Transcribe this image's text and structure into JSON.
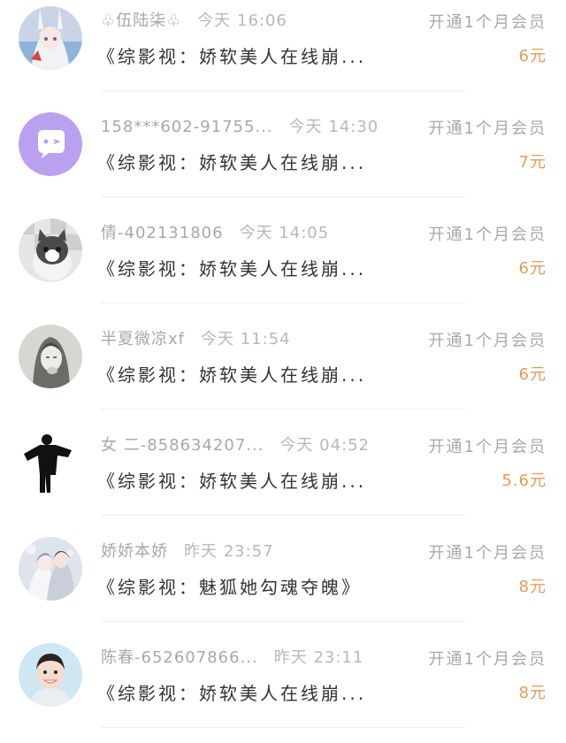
{
  "colors": {
    "secondary_text": "#a8a8a8",
    "primary_text": "#333333",
    "amount": "#e39c55",
    "divider": "#eeeeee"
  },
  "rows": [
    {
      "name": "♧伍陆柒♧",
      "time": "今天 16:06",
      "title": "《综影视：娇软美人在线崩...",
      "action": "开通1个月会员",
      "amount": "6元",
      "avatar": "anime-girl-avatar"
    },
    {
      "name": "158***602-91755...",
      "time": "今天 14:30",
      "title": "《综影视：娇软美人在线崩...",
      "action": "开通1个月会员",
      "amount": "7元",
      "avatar": "default-chat-avatar"
    },
    {
      "name": "倩-402131806",
      "time": "今天 14:05",
      "title": "《综影视：娇软美人在线崩...",
      "action": "开通1个月会员",
      "amount": "6元",
      "avatar": "cat-avatar"
    },
    {
      "name": "半夏微凉xf",
      "time": "今天 11:54",
      "title": "《综影视：娇软美人在线崩...",
      "action": "开通1个月会员",
      "amount": "6元",
      "avatar": "sketch-portrait-avatar"
    },
    {
      "name": "女 二-858634207...",
      "time": "今天 04:52",
      "title": "《综影视：娇软美人在线崩...",
      "action": "开通1个月会员",
      "amount": "5.6元",
      "avatar": "silhouette-avatar"
    },
    {
      "name": "娇娇本娇",
      "time": "昨天 23:57",
      "title": "《综影视：魅狐她勾魂夺魄》",
      "action": "开通1个月会员",
      "amount": "8元",
      "avatar": "anime-couple-avatar"
    },
    {
      "name": "陈春-652607866...",
      "time": "昨天 23:11",
      "title": "《综影视：娇软美人在线崩...",
      "action": "开通1个月会员",
      "amount": "8元",
      "avatar": "boy-photo-avatar"
    }
  ]
}
